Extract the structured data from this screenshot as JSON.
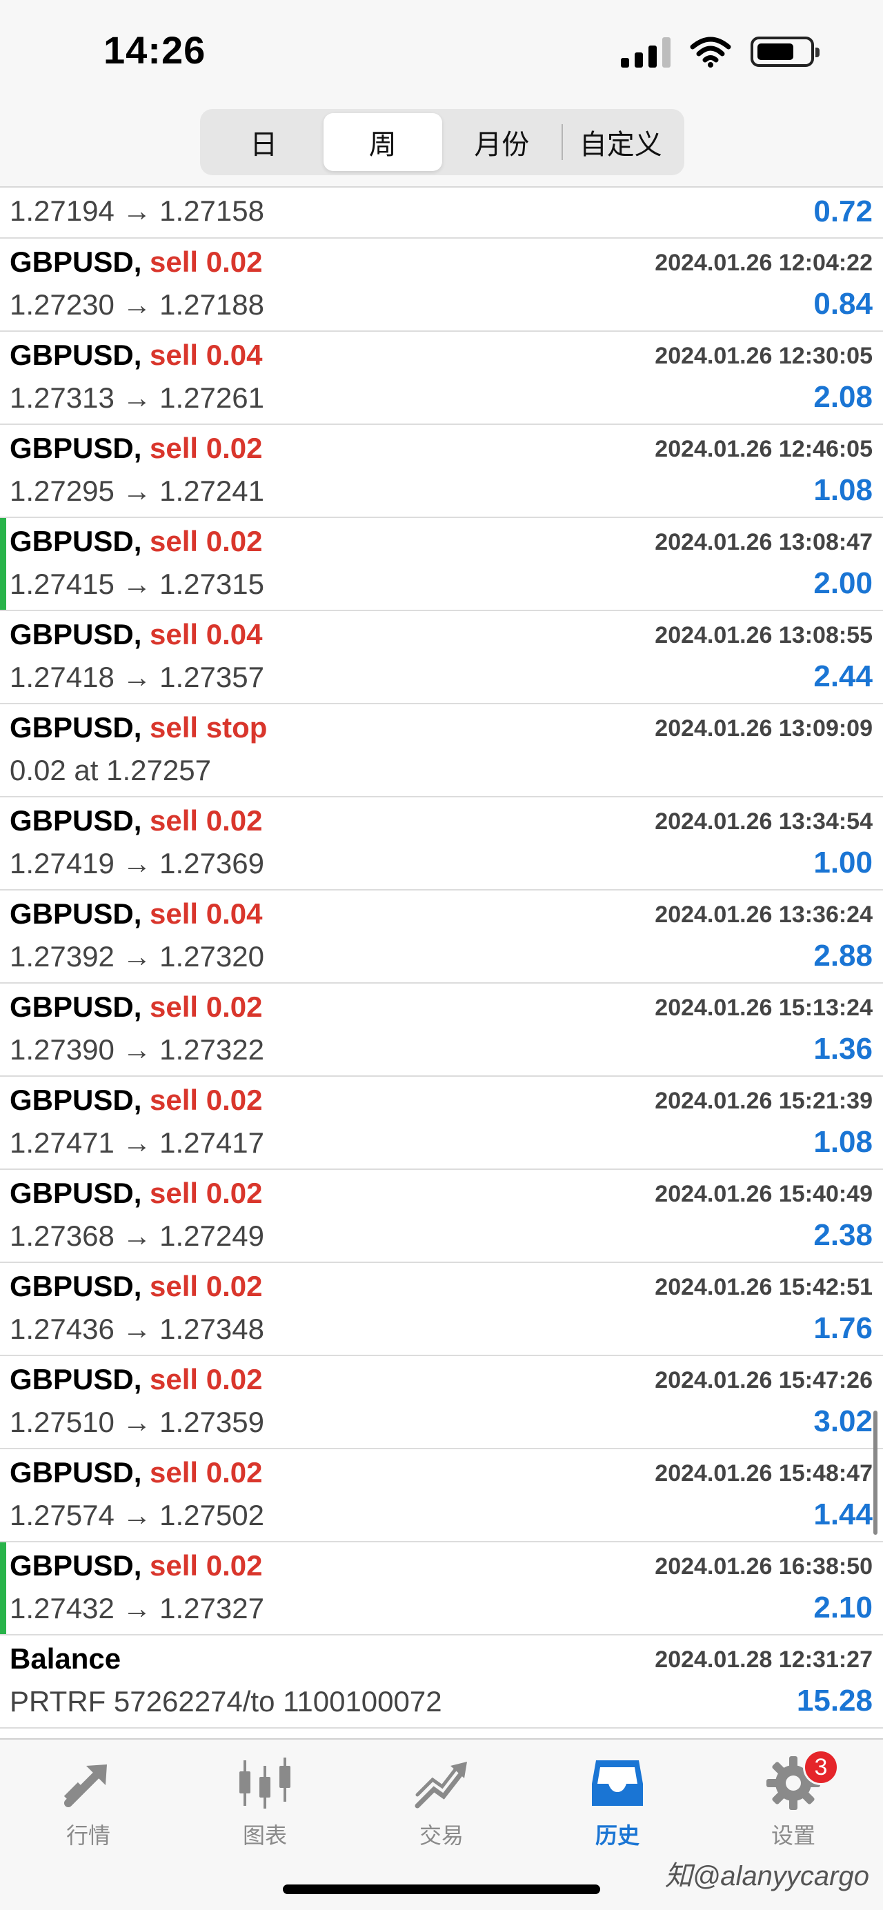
{
  "status": {
    "time": "14:26"
  },
  "periods": [
    {
      "label": "日"
    },
    {
      "label": "周"
    },
    {
      "label": "月份"
    },
    {
      "label": "自定义"
    }
  ],
  "partial_row": {
    "prices": "1.27194 → 1.27158",
    "profit": "0.72"
  },
  "trades": [
    {
      "symbol": "GBPUSD,",
      "side": "sell 0.02",
      "datetime": "2024.01.26 12:04:22",
      "prices": "1.27230 → 1.27188",
      "profit": "0.84"
    },
    {
      "symbol": "GBPUSD,",
      "side": "sell 0.04",
      "datetime": "2024.01.26 12:30:05",
      "prices": "1.27313 → 1.27261",
      "profit": "2.08"
    },
    {
      "symbol": "GBPUSD,",
      "side": "sell 0.02",
      "datetime": "2024.01.26 12:46:05",
      "prices": "1.27295 → 1.27241",
      "profit": "1.08"
    },
    {
      "symbol": "GBPUSD,",
      "side": "sell 0.02",
      "datetime": "2024.01.26 13:08:47",
      "prices": "1.27415 → 1.27315",
      "profit": "2.00"
    },
    {
      "symbol": "GBPUSD,",
      "side": "sell 0.04",
      "datetime": "2024.01.26 13:08:55",
      "prices": "1.27418 → 1.27357",
      "profit": "2.44"
    },
    {
      "symbol": "GBPUSD,",
      "side": "sell stop",
      "datetime": "2024.01.26 13:09:09",
      "prices": "0.02 at 1.27257",
      "profit": ""
    },
    {
      "symbol": "GBPUSD,",
      "side": "sell 0.02",
      "datetime": "2024.01.26 13:34:54",
      "prices": "1.27419 → 1.27369",
      "profit": "1.00"
    },
    {
      "symbol": "GBPUSD,",
      "side": "sell 0.04",
      "datetime": "2024.01.26 13:36:24",
      "prices": "1.27392 → 1.27320",
      "profit": "2.88"
    },
    {
      "symbol": "GBPUSD,",
      "side": "sell 0.02",
      "datetime": "2024.01.26 15:13:24",
      "prices": "1.27390 → 1.27322",
      "profit": "1.36"
    },
    {
      "symbol": "GBPUSD,",
      "side": "sell 0.02",
      "datetime": "2024.01.26 15:21:39",
      "prices": "1.27471 → 1.27417",
      "profit": "1.08"
    },
    {
      "symbol": "GBPUSD,",
      "side": "sell 0.02",
      "datetime": "2024.01.26 15:40:49",
      "prices": "1.27368 → 1.27249",
      "profit": "2.38"
    },
    {
      "symbol": "GBPUSD,",
      "side": "sell 0.02",
      "datetime": "2024.01.26 15:42:51",
      "prices": "1.27436 → 1.27348",
      "profit": "1.76"
    },
    {
      "symbol": "GBPUSD,",
      "side": "sell 0.02",
      "datetime": "2024.01.26 15:47:26",
      "prices": "1.27510 → 1.27359",
      "profit": "3.02"
    },
    {
      "symbol": "GBPUSD,",
      "side": "sell 0.02",
      "datetime": "2024.01.26 15:48:47",
      "prices": "1.27574 → 1.27502",
      "profit": "1.44"
    },
    {
      "symbol": "GBPUSD,",
      "side": "sell 0.02",
      "datetime": "2024.01.26 16:38:50",
      "prices": "1.27432 → 1.27327",
      "profit": "2.10"
    },
    {
      "symbol": "Balance",
      "side": "",
      "datetime": "2024.01.28 12:31:27",
      "prices": "PRTRF 57262274/to 1100100072",
      "profit": "15.28"
    }
  ],
  "tabs": [
    {
      "label": "行情",
      "icon": "quotes-arrows-icon"
    },
    {
      "label": "图表",
      "icon": "candlestick-chart-icon"
    },
    {
      "label": "交易",
      "icon": "trade-trend-icon"
    },
    {
      "label": "历史",
      "icon": "history-inbox-icon"
    },
    {
      "label": "设置",
      "icon": "gear-icon"
    }
  ],
  "settings_badge": "3",
  "watermark": "知@alanyycargo",
  "colors": {
    "sell": "#d9362c",
    "profit": "#1a75d4",
    "accent_bar": "#29b34a",
    "active_tab": "#1a75d4"
  }
}
